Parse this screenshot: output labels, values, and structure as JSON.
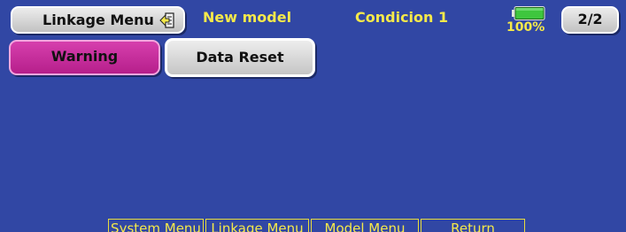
{
  "header": {
    "menu_title": "Linkage Menu",
    "model_name": "New model",
    "condition": "Condicion 1",
    "battery_percent": "100%",
    "battery_level": 1.0,
    "page_indicator": "2/2"
  },
  "main": {
    "buttons": [
      {
        "label": "Warning"
      },
      {
        "label": "Data Reset"
      }
    ]
  },
  "bottom_bar": {
    "items": [
      {
        "label": "System Menu"
      },
      {
        "label": "Linkage Menu"
      },
      {
        "label": "Model Menu"
      },
      {
        "label": "Return"
      }
    ]
  },
  "colors": {
    "background": "#3147a4",
    "header_text": "#f5e94a",
    "selected_button": "#c62c9c",
    "button_face": "#d9d9d9",
    "battery_fill": "#3ec63e"
  },
  "icons": {
    "back": "back-arrow-icon",
    "battery": "battery-icon"
  }
}
